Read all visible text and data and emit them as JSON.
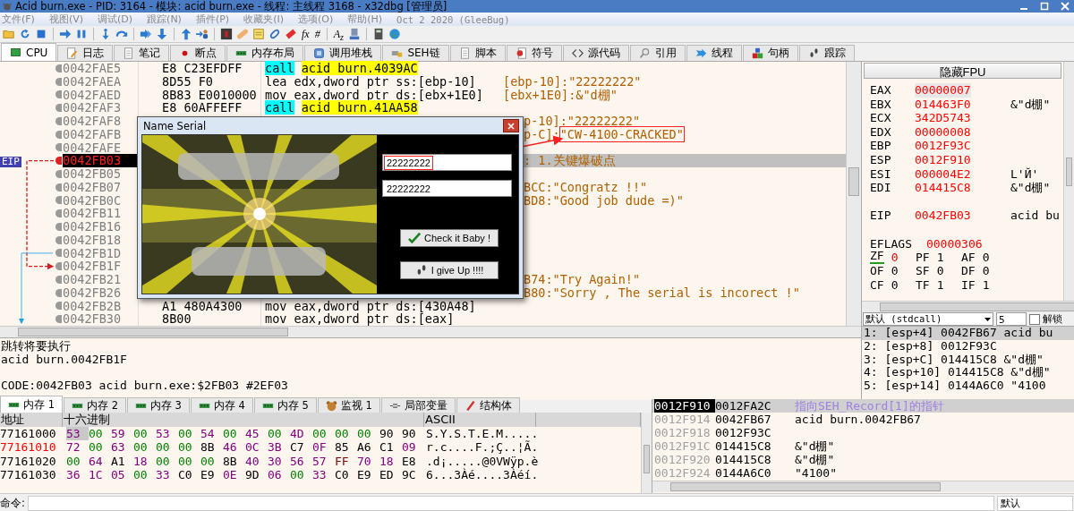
{
  "window": {
    "title": "Acid burn.exe - PID: 3164 - 模块: acid burn.exe - 线程: 主线程 3168 - x32dbg [管理员]"
  },
  "menu": [
    "文件(F)",
    "视图(V)",
    "调试(D)",
    "跟踪(N)",
    "插件(P)",
    "收藏夹(I)",
    "选项(O)",
    "帮助(H)"
  ],
  "build_date": "Oct 2 2020 (GleeBug)",
  "toolbar": [
    {
      "kind": "folder"
    },
    {
      "kind": "restart"
    },
    {
      "kind": "stop"
    },
    {
      "kind": "separator"
    },
    {
      "kind": "run"
    },
    {
      "kind": "pause"
    },
    {
      "kind": "separator"
    },
    {
      "kind": "step-into"
    },
    {
      "kind": "step-over"
    },
    {
      "kind": "separator"
    },
    {
      "kind": "run-to"
    },
    {
      "kind": "down"
    },
    {
      "kind": "separator"
    },
    {
      "kind": "up"
    },
    {
      "kind": "user"
    },
    {
      "kind": "separator"
    },
    {
      "kind": "tile"
    },
    {
      "kind": "bandage"
    },
    {
      "kind": "note"
    },
    {
      "kind": "link"
    },
    {
      "kind": "eraser"
    },
    {
      "kind": "text",
      "label": "fx"
    },
    {
      "kind": "text",
      "label": "#"
    },
    {
      "kind": "separator"
    },
    {
      "kind": "text",
      "label": "A$_{z}$"
    },
    {
      "kind": "device"
    },
    {
      "kind": "separator"
    },
    {
      "kind": "calculator"
    },
    {
      "kind": "globe"
    }
  ],
  "tabs": [
    {
      "label": "CPU",
      "selected": true
    },
    {
      "label": "日志",
      "selected": false
    },
    {
      "label": "笔记",
      "selected": false
    },
    {
      "label": "断点",
      "selected": false
    },
    {
      "label": "内存布局",
      "selected": false
    },
    {
      "label": "调用堆栈",
      "selected": false
    },
    {
      "label": "SEH链",
      "selected": false
    },
    {
      "label": "脚本",
      "selected": false
    },
    {
      "label": "符号",
      "selected": false
    },
    {
      "label": "源代码",
      "selected": false
    },
    {
      "label": "引用",
      "selected": false
    },
    {
      "label": "线程",
      "selected": false
    },
    {
      "label": "句柄",
      "selected": false
    },
    {
      "label": "跟踪",
      "selected": false
    }
  ],
  "disassembly": {
    "eip_label": "EIP",
    "rows": [
      {
        "address": "0042FAE5",
        "bytes": "E8 C23EFDFF",
        "mnemonic": "call",
        "operands": "acid burn.4039AC",
        "kind": "call",
        "current": false
      },
      {
        "address": "0042FAEA",
        "bytes": "8D55 F0",
        "mnemonic": "lea",
        "operands": "edx,dword ptr ss:[ebp-10]",
        "comment": "[ebp-10]:\"22222222\"",
        "kind": "plain",
        "current": false
      },
      {
        "address": "0042FAED",
        "bytes": "8B83 E0010000",
        "mnemonic": "mov",
        "operands": "eax,dword ptr ds:[ebx+1E0]",
        "comment": "[ebx+1E0]:&\"d棚\"",
        "kind": "plain",
        "current": false
      },
      {
        "address": "0042FAF3",
        "bytes": "E8 60AFFEFF",
        "mnemonic": "call",
        "operands": "acid burn.41AA58",
        "kind": "call",
        "current": false
      },
      {
        "address": "0042FAF8",
        "comment": "p-10]:\"22222222\"",
        "kind": "covered",
        "current": false
      },
      {
        "address": "0042FAFB",
        "comment": "p-C]:",
        "annotated_comment": "\"CW-4100-CRACKED\"",
        "kind": "covered",
        "current": false
      },
      {
        "address": "0042FAFE",
        "kind": "covered",
        "current": false
      },
      {
        "address": "0042FB03",
        "comment": ": 1.关键爆破点",
        "kind": "covered",
        "current": true
      },
      {
        "address": "0042FB05",
        "kind": "covered",
        "current": false
      },
      {
        "address": "0042FB07",
        "comment": "BCC:\"Congratz !!\"",
        "kind": "covered",
        "current": false
      },
      {
        "address": "0042FB0C",
        "comment": "BD8:\"Good job dude =)\"",
        "kind": "covered",
        "current": false
      },
      {
        "address": "0042FB11",
        "kind": "covered",
        "current": false
      },
      {
        "address": "0042FB16",
        "kind": "covered",
        "current": false
      },
      {
        "address": "0042FB18",
        "kind": "covered",
        "current": false
      },
      {
        "address": "0042FB1D",
        "kind": "covered",
        "current": false
      },
      {
        "address": "0042FB1F",
        "kind": "covered",
        "current": false
      },
      {
        "address": "0042FB21",
        "comment": "B74:\"Try Again!\"",
        "kind": "covered",
        "current": false
      },
      {
        "address": "0042FB26",
        "comment": "B80:\"Sorry , The serial is incorect !\"",
        "kind": "covered",
        "current": false
      },
      {
        "address": "0042FB2B",
        "bytes": "A1 480A4300",
        "mnemonic": "mov",
        "operands": "eax,dword ptr ds:[430A48]",
        "kind": "plain",
        "current": false
      },
      {
        "address": "0042FB30",
        "bytes": "8B00",
        "mnemonic": "mov",
        "operands": "eax,dword ptr ds:[eax]",
        "kind": "plain",
        "current": false
      }
    ]
  },
  "dialog": {
    "title": "Name Serial",
    "fields": [
      {
        "value": "22222222",
        "annotated": true
      },
      {
        "value": "22222222",
        "annotated": false
      }
    ],
    "buttons": [
      {
        "label": "Check it Baby !",
        "kind": "check"
      },
      {
        "label": "I give Up !!!!",
        "kind": "quit"
      }
    ]
  },
  "annotation_arrow": true,
  "info": {
    "jump_note": "跳转将要执行",
    "jump_target": "acid burn.0042FB1F",
    "location": "CODE:0042FB03 acid burn.exe:$2FB03 #2EF03"
  },
  "registers": {
    "toggle_label": "隐藏FPU",
    "general": [
      {
        "name": "EAX",
        "value": "00000007",
        "selected": true
      },
      {
        "name": "EBX",
        "value": "014463F0",
        "comment": "&\"d棚\"",
        "selected": false
      },
      {
        "name": "ECX",
        "value": "342D5743",
        "selected": false
      },
      {
        "name": "EDX",
        "value": "00000008",
        "selected": false
      },
      {
        "name": "EBP",
        "value": "0012F93C",
        "selected": false
      },
      {
        "name": "ESP",
        "value": "0012F910",
        "selected": false
      },
      {
        "name": "ESI",
        "value": "000004E2",
        "comment": "L'Й'",
        "selected": false
      },
      {
        "name": "EDI",
        "value": "014415C8",
        "comment": "&\"d棚\"",
        "selected": false
      }
    ],
    "eip": {
      "name": "EIP",
      "value": "0042FB03",
      "comment": "acid bu"
    },
    "eflags": {
      "name": "EFLAGS",
      "value": "00000306"
    },
    "flags": [
      [
        {
          "name": "ZF",
          "value": "0",
          "changed": true
        },
        {
          "name": "PF",
          "value": "1",
          "changed": false
        },
        {
          "name": "AF",
          "value": "0",
          "changed": false
        }
      ],
      [
        {
          "name": "OF",
          "value": "0",
          "changed": false
        },
        {
          "name": "SF",
          "value": "0",
          "changed": false
        },
        {
          "name": "DF",
          "value": "0",
          "changed": false
        }
      ],
      [
        {
          "name": "CF",
          "value": "0",
          "changed": false
        },
        {
          "name": "TF",
          "value": "1",
          "changed": false
        },
        {
          "name": "IF",
          "value": "1",
          "changed": false
        }
      ]
    ]
  },
  "callstack": {
    "convention": "默认 (stdcall)",
    "arg_count": "5",
    "unlock_label": "解锁",
    "unlock_checked": false,
    "rows": [
      {
        "text": "1: [esp+4] 0042FB67 acid bu",
        "selected": true
      },
      {
        "text": "2: [esp+8] 0012F93C",
        "selected": false
      },
      {
        "text": "3: [esp+C] 014415C8 &\"d棚\"",
        "selected": false
      },
      {
        "text": "4: [esp+10] 014415C8 &\"d棚\"",
        "selected": false
      },
      {
        "text": "5: [esp+14] 0144A6C0 \"4100",
        "selected": false
      }
    ]
  },
  "memory_tabs": [
    {
      "label": "内存 1",
      "selected": true
    },
    {
      "label": "内存 2",
      "selected": false
    },
    {
      "label": "内存 3",
      "selected": false
    },
    {
      "label": "内存 4",
      "selected": false
    },
    {
      "label": "内存 5",
      "selected": false
    },
    {
      "label": "监视 1",
      "selected": false
    },
    {
      "label": "局部变量",
      "selected": false
    },
    {
      "label": "结构体",
      "selected": false
    }
  ],
  "dump": {
    "columns": [
      "地址",
      "十六进制",
      "ASCII"
    ],
    "rows": [
      {
        "address": "77161000",
        "modified": false,
        "cursor": true,
        "bytes": [
          "53",
          "00",
          "59",
          "00",
          "53",
          "00",
          "54",
          "00",
          "45",
          "00",
          "4D",
          "00",
          "00",
          "00",
          "90",
          "90"
        ],
        "ascii": "S.Y.S.T.E.M....."
      },
      {
        "address": "77161010",
        "modified": true,
        "cursor": false,
        "bytes": [
          "72",
          "00",
          "63",
          "00",
          "00",
          "00",
          "8B",
          "46",
          "0C",
          "3B",
          "C7",
          "0F",
          "85",
          "A6",
          "C1",
          "09"
        ],
        "ascii": "r.c....F.;Ç..¦Ã."
      },
      {
        "address": "77161020",
        "modified": false,
        "cursor": false,
        "bytes": [
          "00",
          "64",
          "A1",
          "18",
          "00",
          "00",
          "00",
          "8B",
          "40",
          "30",
          "56",
          "57",
          "FF",
          "70",
          "18",
          "E8"
        ],
        "ascii": ".d¡.....@0VWÿp.è"
      },
      {
        "address": "77161030",
        "modified": false,
        "cursor": false,
        "bytes": [
          "36",
          "1C",
          "05",
          "00",
          "33",
          "C0",
          "E9",
          "0E",
          "9D",
          "06",
          "00",
          "33",
          "C0",
          "E9",
          "ED",
          "9C"
        ],
        "ascii": "6...3Àé....3Àéí."
      }
    ]
  },
  "stack": {
    "rows": [
      {
        "address": "0012F910",
        "value": "0012FA2C",
        "comment": "指向SEH_Record[1]的指针",
        "selected": true
      },
      {
        "address": "0012F914",
        "value": "0042FB67",
        "comment": "acid burn.0042FB67",
        "selected": false
      },
      {
        "address": "0012F918",
        "value": "0012F93C",
        "selected": false
      },
      {
        "address": "0012F91C",
        "value": "014415C8",
        "comment": "&\"d棚\"",
        "selected": false
      },
      {
        "address": "0012F920",
        "value": "014415C8",
        "comment": "&\"d棚\"",
        "selected": false
      },
      {
        "address": "0012F924",
        "value": "0144A6C0",
        "comment": "\"4100\"",
        "selected": false
      }
    ]
  },
  "command": {
    "label": "命令:",
    "mode": "默认"
  }
}
